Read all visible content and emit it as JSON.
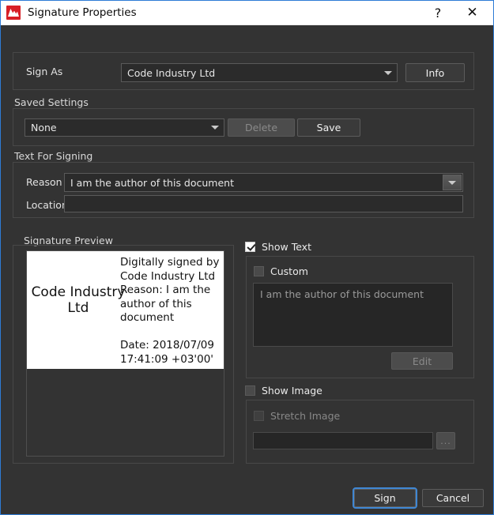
{
  "window": {
    "title": "Signature Properties",
    "app_icon": "master-pdf-editor-icon",
    "help_label": "?",
    "close_label": "✕",
    "accent_color": "#2e7cd6",
    "background_color": "#333333",
    "titlebar_color": "#ffffff"
  },
  "sign_as": {
    "label": "Sign As",
    "value": "Code Industry Ltd",
    "info_button": "Info"
  },
  "saved_settings": {
    "group_label": "Saved Settings",
    "value": "None",
    "delete_button": "Delete",
    "delete_enabled": false,
    "save_button": "Save",
    "save_enabled": true
  },
  "text_for_signing": {
    "group_label": "Text For Signing",
    "reason_label": "Reason",
    "reason_value": "I am the author of this document",
    "location_label": "Location",
    "location_value": "",
    "location_placeholder": ""
  },
  "signature_preview": {
    "group_label": "Signature Preview",
    "left_text": "Code Industry Ltd",
    "details_text": "Digitally signed by Code Industry Ltd Reason: I am the author of this document",
    "date_text": "Date: 2018/07/09 17:41:09 +03'00'"
  },
  "show_text": {
    "label": "Show Text",
    "checked": true,
    "custom_label": "Custom",
    "custom_checked": false,
    "custom_text": "I am the author of this document",
    "edit_button": "Edit",
    "edit_enabled": false
  },
  "show_image": {
    "label": "Show Image",
    "checked": false,
    "stretch_label": "Stretch Image",
    "stretch_checked": false,
    "stretch_enabled": false,
    "path_value": "",
    "browse_button": "...",
    "browse_enabled": false
  },
  "footer": {
    "sign_button": "Sign",
    "cancel_button": "Cancel",
    "focused_button": "Sign"
  }
}
